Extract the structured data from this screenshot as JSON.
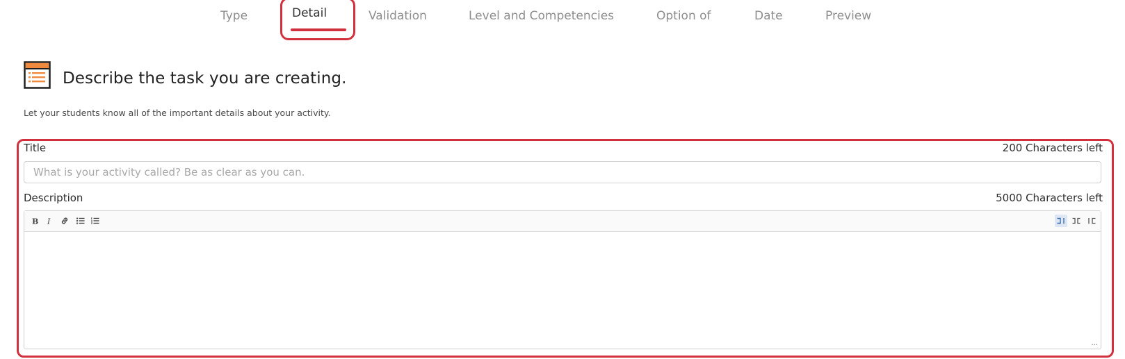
{
  "tabs": [
    {
      "label": "Type",
      "active": false
    },
    {
      "label": "Detail",
      "active": true
    },
    {
      "label": "Validation",
      "active": false
    },
    {
      "label": "Level and Competencies",
      "active": false
    },
    {
      "label": "Option of",
      "active": false
    },
    {
      "label": "Date",
      "active": false
    },
    {
      "label": "Preview",
      "active": false
    }
  ],
  "header": {
    "icon": "task-list-icon",
    "title": "Describe the task you are creating.",
    "subtitle": "Let your students know all of the important details about your activity."
  },
  "form": {
    "title_field": {
      "label": "Title",
      "counter": "200 Characters left",
      "placeholder": "What is your activity called? Be as clear as you can.",
      "value": ""
    },
    "description_field": {
      "label": "Description",
      "counter": "5000 Characters left",
      "value": "",
      "resize_handle": "..."
    },
    "toolbar": {
      "left": [
        "bold-icon",
        "italic-icon",
        "link-icon",
        "bulleted-list-icon",
        "numbered-list-icon"
      ],
      "right": [
        "align-left-icon",
        "align-center-icon",
        "align-right-icon"
      ],
      "active": "align-left-icon"
    }
  },
  "colors": {
    "highlight": "#d1313c",
    "tab_active_text": "#333333",
    "tab_inactive_text": "#8e8e8e",
    "icon_orange": "#f08a3e"
  }
}
